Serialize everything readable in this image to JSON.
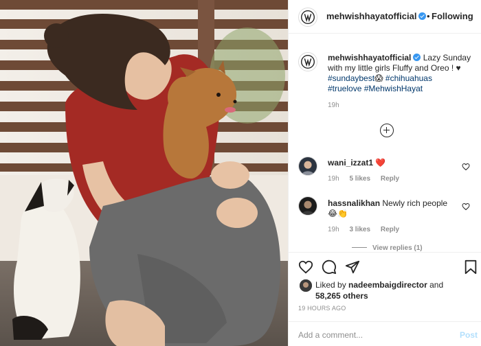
{
  "post": {
    "username": "mehwishhayatofficial",
    "follow_separator": "•",
    "follow_label": "Following",
    "caption_text": "Lazy Sunday with my little girls Fluffy and Oreo ! ♥",
    "hashtags": [
      "#sundaybest",
      "#chihuahuas",
      "#truelove",
      "#MehwishHayat"
    ],
    "caption_emoji": "😱",
    "caption_time": "19h"
  },
  "comments": [
    {
      "username": "wani_izzat1",
      "text": "",
      "emoji": "❤️",
      "time": "19h",
      "likes": "5 likes",
      "reply": "Reply"
    },
    {
      "username": "hassnalikhan",
      "text": "Newly rich people",
      "emoji": "😂👏",
      "time": "19h",
      "likes": "3 likes",
      "reply": "Reply"
    }
  ],
  "view_replies": "View replies (1)",
  "likes": {
    "prefix": "Liked by",
    "user": "nadeembaigdirector",
    "and": "and",
    "count": "58,265 others"
  },
  "timestamp": "19 HOURS AGO",
  "composer": {
    "placeholder": "Add a comment...",
    "post_label": "Post"
  },
  "icons": {
    "like": "heart-icon",
    "comment": "comment-icon",
    "share": "share-icon",
    "save": "bookmark-icon",
    "load_more": "plus-circle-icon"
  },
  "colors": {
    "hashtag": "#00376b",
    "verified": "#3897f0",
    "comment_heart": "#ed4956",
    "post_button": "#b2dffc",
    "muted": "#8e8e8e"
  }
}
